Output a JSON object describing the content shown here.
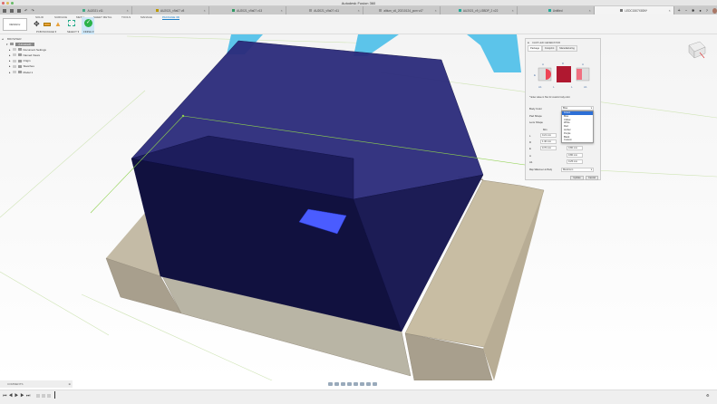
{
  "app": {
    "title": "Autodesk Fusion 360"
  },
  "tabs": [
    {
      "label": "AU2021 v11",
      "color": "#4a8"
    },
    {
      "label": "AU2021_v9a07 v8",
      "color": "#b90"
    },
    {
      "label": "AU2021_v9a07 v13",
      "color": "#396"
    },
    {
      "label": "AU2021_v9a07 v11",
      "color": "#999"
    },
    {
      "label": "altium_v6_20210124_pcm v47",
      "color": "#999"
    },
    {
      "label": "AU2021_v9_LSBDP_2 v22",
      "color": "#2a9"
    },
    {
      "label": "Untitled",
      "color": "#2a9"
    },
    {
      "label": "LEDC1507X80N*",
      "color": "#777",
      "active": true
    }
  ],
  "toolbar": {
    "workspace": "DESIGN ▾",
    "tabs": [
      "SOLID",
      "SURFACE",
      "MESH",
      "SHEET METAL",
      "TOOLS",
      "MANAGE",
      "PACKAGE 3D"
    ],
    "active_tab": "PACKAGE 3D",
    "groups": {
      "pcb_package": "PCB PACKAGE ▾",
      "select": "SELECT ▾",
      "finish": "FINISH ▾"
    }
  },
  "browser": {
    "title": "BROWSER",
    "root": "(Unsaved)",
    "items": [
      "Document Settings",
      "Named Views",
      "Origin",
      "Sketches",
      "Model 1"
    ]
  },
  "dialog": {
    "title": "CHIP LED GENERATOR",
    "tabs": [
      "Package",
      "Footprint",
      "Manufacturing"
    ],
    "active_tab": "Package",
    "diagram_labels": {
      "a": "A",
      "d": "D",
      "e": "E",
      "a1": "A1",
      "l": "L"
    },
    "note": "* Enter value in Hex for custom body color.",
    "body_color_label": "Body Color",
    "body_color_value": "Blue",
    "pad_shape_label": "Pad Shape",
    "lens_shape_label": "Lens Shape",
    "color_options": [
      "Green",
      "Blue",
      "Yellow",
      "White",
      "Red",
      "Amber",
      "Purple",
      "Black",
      "Custom"
    ],
    "highlighted_option": "Green",
    "min_header": "Min",
    "params": [
      {
        "label": "L",
        "min": "0.21 mm",
        "max": ""
      },
      {
        "label": "D",
        "min": "1.40 mm",
        "max": ""
      },
      {
        "label": "E",
        "min": "0.70 mm",
        "max": "0.80 mm"
      },
      {
        "label": "A",
        "min": "",
        "max": "0.80 mm"
      },
      {
        "label": "A1",
        "min": "",
        "max": "0.25 mm"
      }
    ],
    "silkscreen_label": "Map Silkscreen to Body",
    "silkscreen_value": "Maximum",
    "update": "Update",
    "cancel": "Cancel"
  },
  "comments": {
    "label": "COMMENTS"
  },
  "colors": {
    "body": "#1a1a6e",
    "lens": "#4a5cff",
    "terminal": "#c8bfa8",
    "accent": "#1b7fc9"
  }
}
